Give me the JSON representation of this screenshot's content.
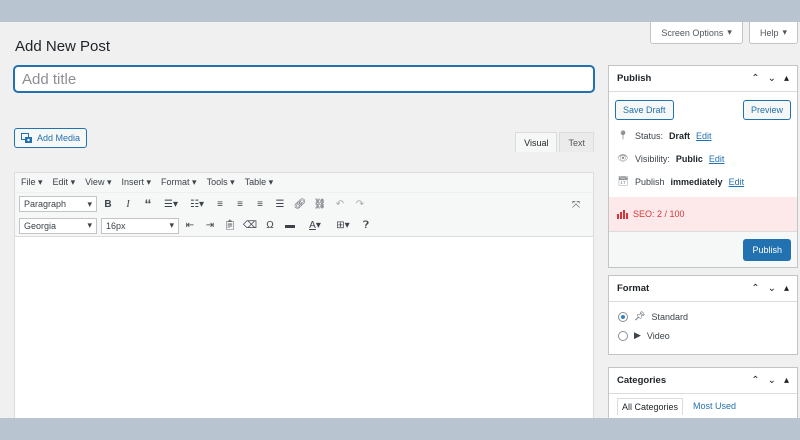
{
  "screen_meta": {
    "screen_options": "Screen Options",
    "help": "Help"
  },
  "page": {
    "title": "Add New Post",
    "title_placeholder": "Add title"
  },
  "media": {
    "add_media_label": "Add Media"
  },
  "editor": {
    "tabs": [
      {
        "label": "Visual",
        "active": true
      },
      {
        "label": "Text",
        "active": false
      }
    ],
    "menu": [
      "File",
      "Edit",
      "View",
      "Insert",
      "Format",
      "Tools",
      "Table"
    ],
    "block_format": "Paragraph",
    "font_family": "Georgia",
    "font_size": "16px",
    "toolbar_glyphs": {
      "bold": "B",
      "italic": "I",
      "blockquote": "“",
      "omega": "Ω",
      "text_color": "A"
    }
  },
  "publish": {
    "title": "Publish",
    "save_draft": "Save Draft",
    "preview": "Preview",
    "status_label": "Status:",
    "status_value": "Draft",
    "status_edit": "Edit",
    "visibility_label": "Visibility:",
    "visibility_value": "Public",
    "visibility_edit": "Edit",
    "publish_label": "Publish",
    "publish_value": "immediately",
    "publish_edit": "Edit",
    "seo": "SEO: 2 / 100",
    "publish_button": "Publish"
  },
  "format": {
    "title": "Format",
    "options": [
      {
        "label": "Standard",
        "selected": true
      },
      {
        "label": "Video",
        "selected": false
      }
    ]
  },
  "categories": {
    "title": "Categories",
    "tabs": [
      {
        "label": "All Categories",
        "active": true
      },
      {
        "label": "Most Used",
        "active": false
      }
    ]
  },
  "colors": {
    "accent": "#2271b1",
    "seo_red": "#d63638",
    "seo_bg": "#fde9e9"
  }
}
